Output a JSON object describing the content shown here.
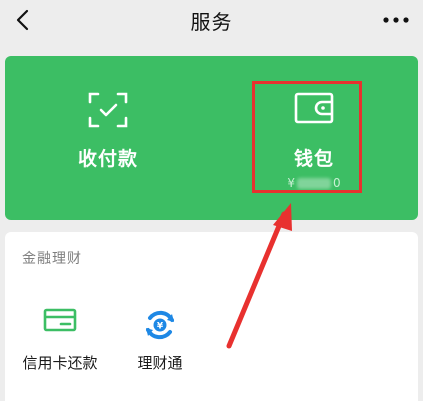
{
  "header": {
    "title": "服务",
    "back_icon": "chevron-left-icon",
    "more_icon": "more-dots-icon"
  },
  "services": {
    "pay": {
      "label": "收付款",
      "icon": "scan-frame-icon"
    },
    "wallet": {
      "label": "钱包",
      "icon": "wallet-icon",
      "balance_prefix": "¥",
      "balance_suffix": "0"
    }
  },
  "finance": {
    "title": "金融理财",
    "items": [
      {
        "label": "信用卡还款",
        "icon": "credit-card-icon"
      },
      {
        "label": "理财通",
        "icon": "licaitong-icon"
      }
    ]
  },
  "colors": {
    "brand_green": "#3cbe64",
    "highlight_red": "#e8312f",
    "credit_icon_green": "#3cbe64",
    "licaitong_blue": "#1e88e5"
  }
}
